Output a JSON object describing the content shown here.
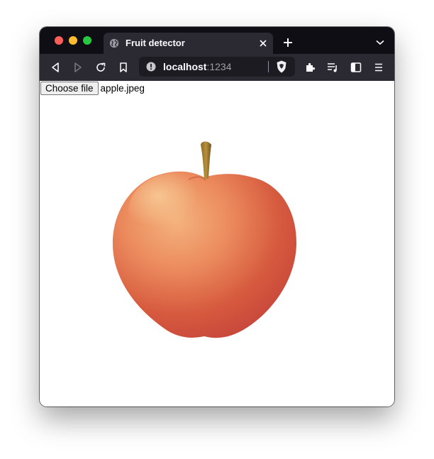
{
  "browser": {
    "tab": {
      "title": "Fruit detector",
      "favicon": "globe-icon"
    },
    "address_bar": {
      "host": "localhost",
      "port": ":1234"
    },
    "toolbar_icons": [
      "back-icon",
      "forward-icon",
      "reload-icon",
      "bookmark-icon",
      "extensions-icon",
      "media-icon",
      "sidebar-icon",
      "menu-icon"
    ]
  },
  "page": {
    "file_input": {
      "button_label": "Choose file",
      "selected_file": "apple.jpeg"
    },
    "image": {
      "subject": "apple"
    }
  },
  "colors": {
    "tabbar": "#0e0e14",
    "toolbar": "#2b2a33",
    "urlbar": "#1c1b22",
    "apple_red": "#d2523a",
    "apple_yellow": "#f2a572"
  }
}
